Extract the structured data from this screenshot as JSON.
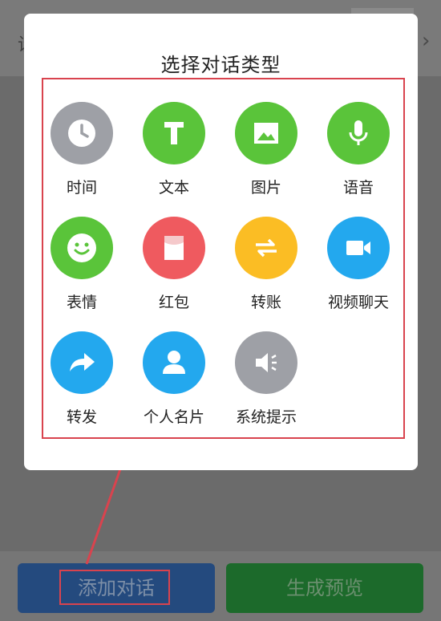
{
  "background": {
    "left_fragment": "设",
    "right_chevron": "›"
  },
  "bottom": {
    "add_label": "添加对话",
    "preview_label": "生成预览"
  },
  "dialog": {
    "title": "选择对话类型",
    "items": [
      {
        "label": "时间",
        "icon": "clock-icon",
        "color": "#9ea0a6"
      },
      {
        "label": "文本",
        "icon": "text-icon",
        "color": "#5ac43a"
      },
      {
        "label": "图片",
        "icon": "image-icon",
        "color": "#5ac43a"
      },
      {
        "label": "语音",
        "icon": "microphone-icon",
        "color": "#5ac43a"
      },
      {
        "label": "表情",
        "icon": "smiley-icon",
        "color": "#5ac43a"
      },
      {
        "label": "红包",
        "icon": "red-packet-icon",
        "color": "#ef5a5f"
      },
      {
        "label": "转账",
        "icon": "transfer-icon",
        "color": "#fbbd24"
      },
      {
        "label": "视频聊天",
        "icon": "video-camera-icon",
        "color": "#23a8ee"
      },
      {
        "label": "转发",
        "icon": "forward-arrow-icon",
        "color": "#23a8ee"
      },
      {
        "label": "个人名片",
        "icon": "person-icon",
        "color": "#23a8ee"
      },
      {
        "label": "系统提示",
        "icon": "speaker-icon",
        "color": "#9ea0a6"
      }
    ]
  },
  "annotation_color": "#d9434e"
}
